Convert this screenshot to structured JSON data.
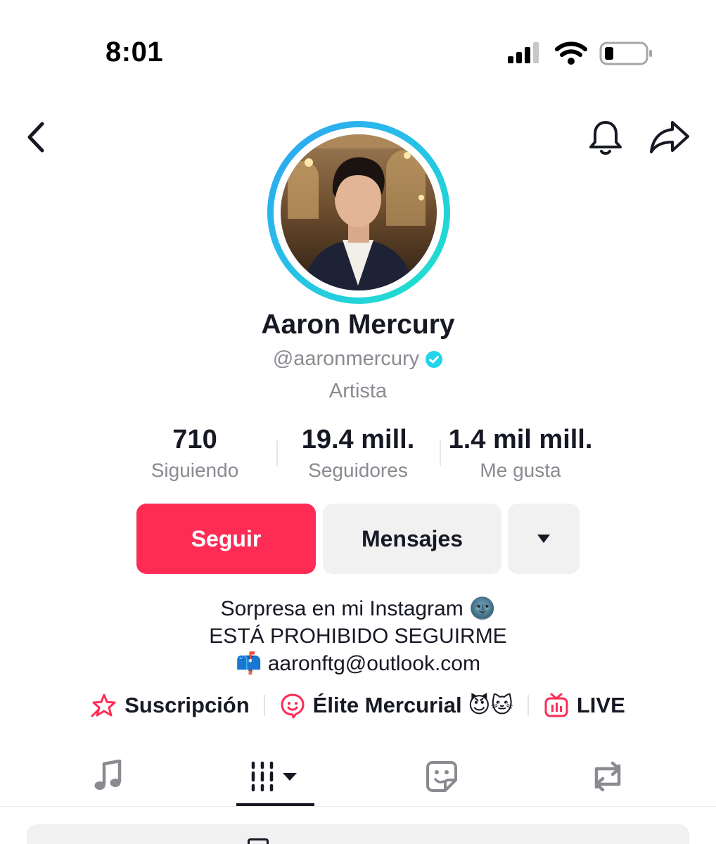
{
  "status_bar": {
    "time": "8:01",
    "icons": [
      "cellular-signal-icon",
      "wifi-icon",
      "battery-icon"
    ]
  },
  "nav": {
    "back_icon": "chevron-left-icon",
    "bell_icon": "bell-icon",
    "share_icon": "share-arrow-icon"
  },
  "profile": {
    "display_name": "Aaron Mercury",
    "handle": "@aaronmercury",
    "verified": true,
    "category": "Artista"
  },
  "stats": [
    {
      "value": "710",
      "label": "Siguiendo"
    },
    {
      "value": "19.4 mill.",
      "label": "Seguidores"
    },
    {
      "value": "1.4 mil mill.",
      "label": "Me gusta"
    }
  ],
  "actions": {
    "follow": "Seguir",
    "message": "Mensajes",
    "more_icon": "caret-down-icon"
  },
  "bio": {
    "lines": [
      "Sorpresa en mi Instagram 🌚",
      "ESTÁ PROHIBIDO SEGUIRME",
      "📫 aaronftg@outlook.com"
    ]
  },
  "links": [
    {
      "label": "Suscripción",
      "icon": "subscription-star-icon"
    },
    {
      "label": "Élite Mercurial 😈🐱",
      "icon": "smile-bubble-icon"
    },
    {
      "label": "LIVE",
      "icon": "live-tv-icon"
    }
  ],
  "tabs": [
    {
      "icon": "music-note-icon",
      "active": false
    },
    {
      "icon": "videos-grid-icon",
      "active": true
    },
    {
      "icon": "sticker-icon",
      "active": false
    },
    {
      "icon": "repost-icon",
      "active": false
    }
  ],
  "colors": {
    "accent": "#fe2c55",
    "secondary_text": "#8a8b91",
    "button_gray": "#f1f1f2",
    "verified": "#20d5ec",
    "avatar_ring_start": "#2fa3f2",
    "avatar_ring_end": "#1ee6c8"
  }
}
